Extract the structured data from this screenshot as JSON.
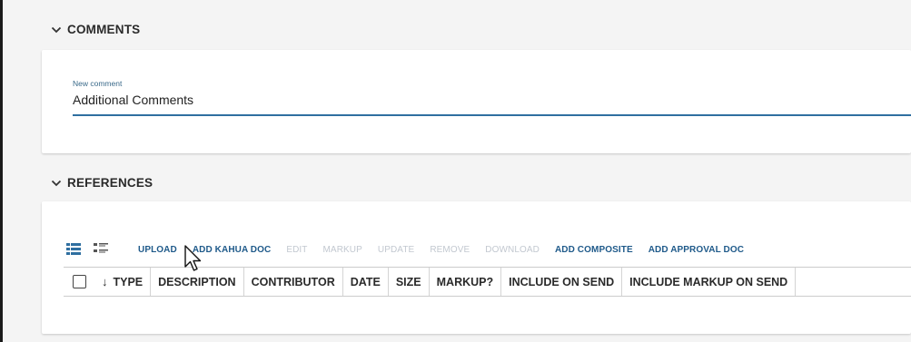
{
  "comments": {
    "header": "COMMENTS",
    "field_label": "New comment",
    "field_value": "Additional Comments"
  },
  "references": {
    "header": "REFERENCES",
    "view_icons": [
      "list-view-icon",
      "detail-view-icon"
    ],
    "toolbar": [
      {
        "label": "UPLOAD",
        "enabled": true
      },
      {
        "label": "ADD KAHUA DOC",
        "enabled": true
      },
      {
        "label": "EDIT",
        "enabled": false
      },
      {
        "label": "MARKUP",
        "enabled": false
      },
      {
        "label": "UPDATE",
        "enabled": false
      },
      {
        "label": "REMOVE",
        "enabled": false
      },
      {
        "label": "DOWNLOAD",
        "enabled": false
      },
      {
        "label": "ADD COMPOSITE",
        "enabled": true
      },
      {
        "label": "ADD APPROVAL DOC",
        "enabled": true
      }
    ],
    "columns": [
      "TYPE",
      "DESCRIPTION",
      "CONTRIBUTOR",
      "DATE",
      "SIZE",
      "MARKUP?",
      "INCLUDE ON SEND",
      "INCLUDE MARKUP ON SEND"
    ],
    "sorted_column": "TYPE",
    "sort_direction": "descending"
  },
  "colors": {
    "accent": "#2f6fa0",
    "enabled_action": "#1f5a8a",
    "disabled_action": "#c2c8d0"
  }
}
